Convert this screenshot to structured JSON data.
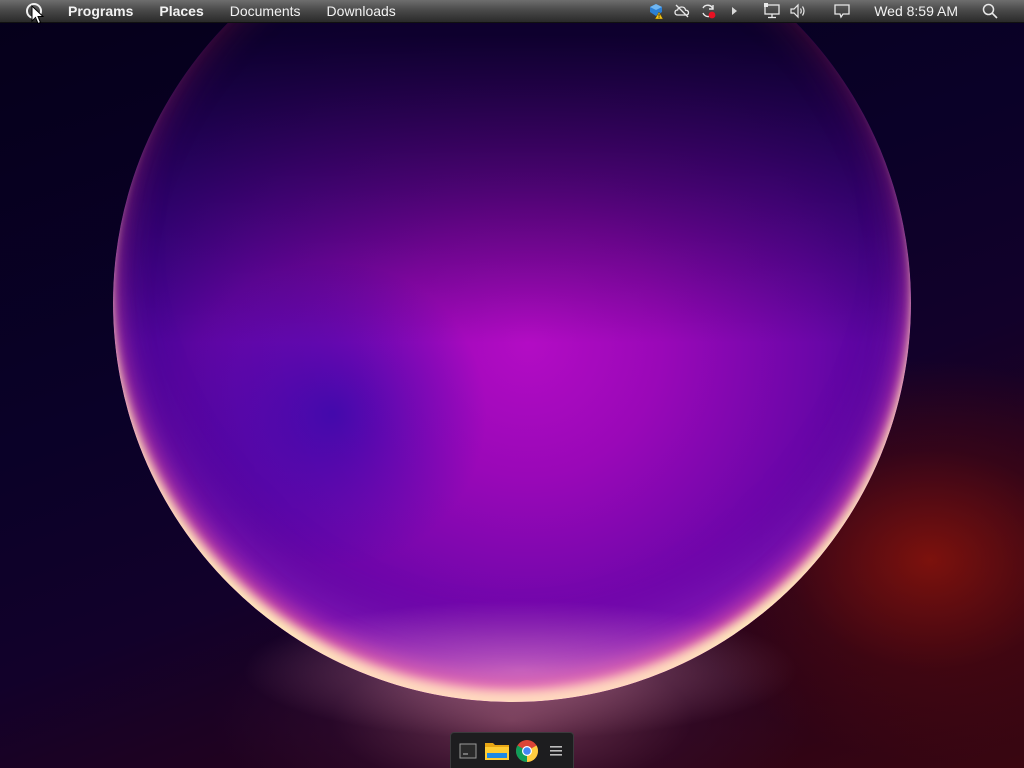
{
  "top_panel": {
    "menus": [
      {
        "label": "Programs"
      },
      {
        "label": "Places"
      },
      {
        "label": "Documents"
      },
      {
        "label": "Downloads"
      }
    ],
    "tray_icons": [
      "network-warning-icon",
      "cloud-off-icon",
      "sync-error-icon",
      "expand-arrow-icon",
      "ethernet-icon",
      "volume-icon",
      "notification-icon"
    ],
    "clock": "Wed 8:59 AM",
    "search_icon": "search-icon"
  },
  "dock": {
    "items": [
      "terminal-icon",
      "file-manager-icon",
      "chrome-icon",
      "menu-icon"
    ]
  },
  "colors": {
    "panel_top": "#6e6e6e",
    "panel_bottom": "#2a2a2a",
    "orb_core": "#b30cc4",
    "orb_rim": "#ffd9a0",
    "dock_bg": "#1d1d1f",
    "sync_error": "#e81123",
    "warning": "#f5c518"
  }
}
